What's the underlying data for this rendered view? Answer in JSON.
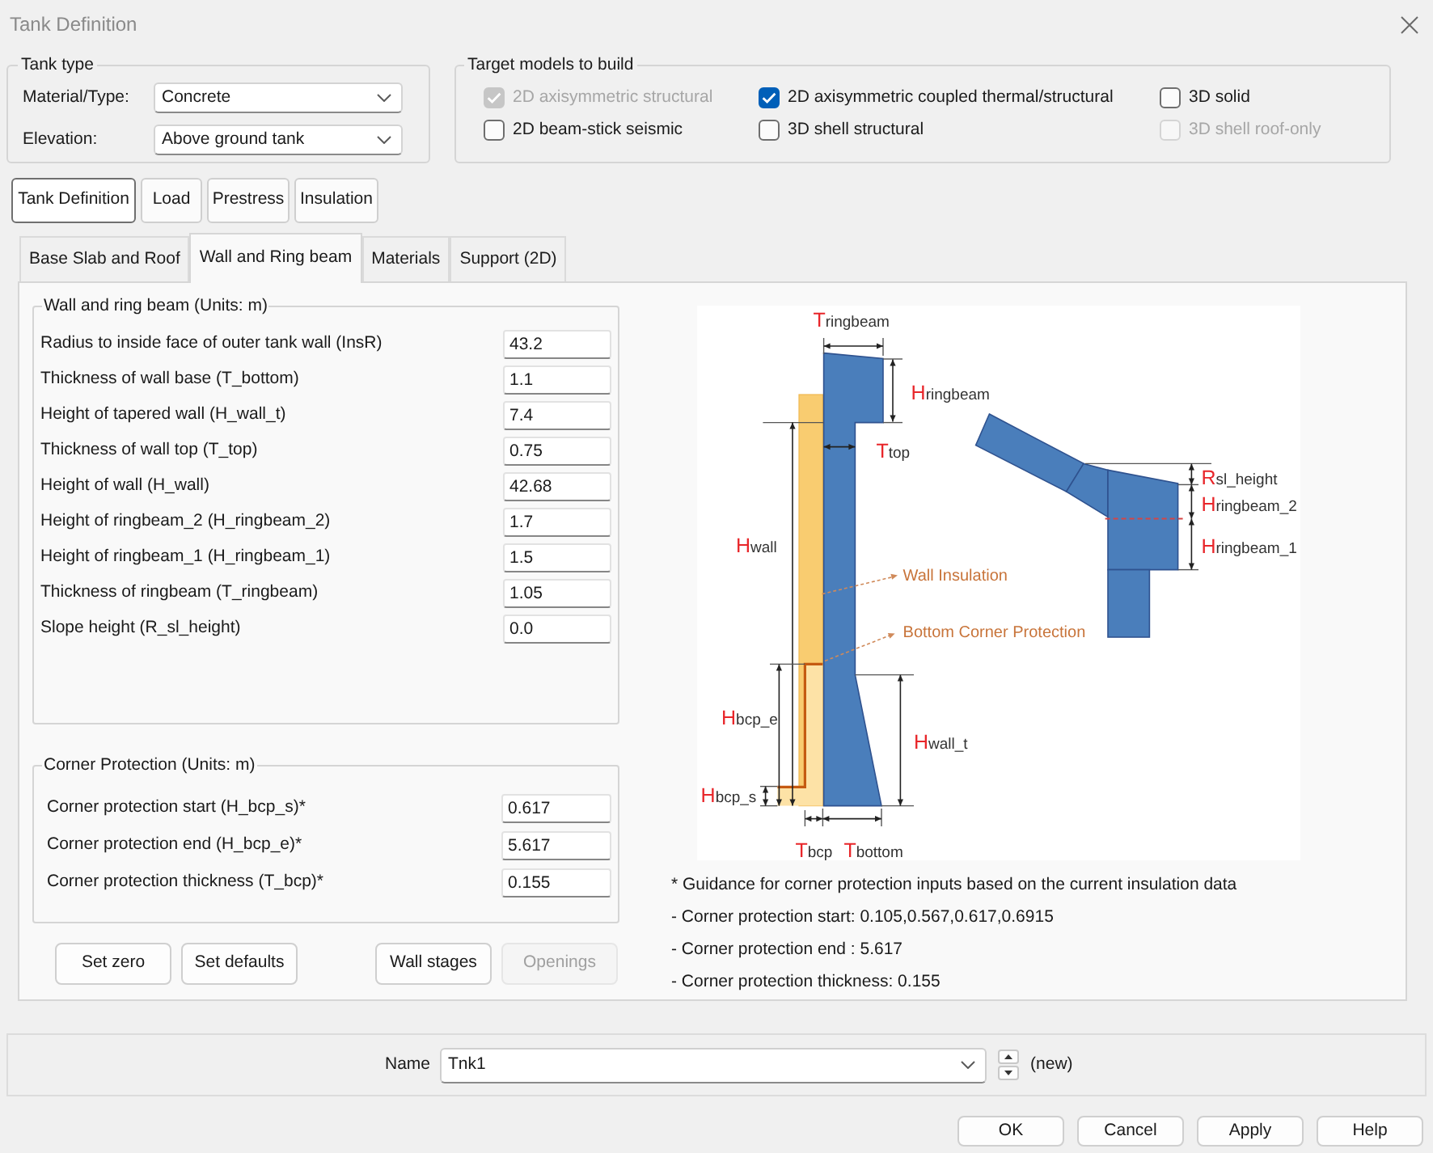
{
  "window": {
    "title": "Tank Definition"
  },
  "tank_type": {
    "title": "Tank type",
    "fields": [
      {
        "label": "Material/Type:",
        "value": "Concrete"
      },
      {
        "label": "Elevation:",
        "value": "Above ground tank"
      }
    ]
  },
  "target_models": {
    "title": "Target models to build",
    "options": [
      {
        "label": "2D axisymmetric structural",
        "checked": true,
        "disabled": true
      },
      {
        "label": "2D axisymmetric coupled thermal/structural",
        "checked": true,
        "disabled": false
      },
      {
        "label": "3D solid",
        "checked": false,
        "disabled": false
      },
      {
        "label": "2D beam-stick seismic",
        "checked": false,
        "disabled": false
      },
      {
        "label": "3D shell structural",
        "checked": false,
        "disabled": false
      },
      {
        "label": "3D shell roof-only",
        "checked": false,
        "disabled": true
      }
    ]
  },
  "main_tabs": [
    {
      "label": "Tank Definition",
      "selected": true
    },
    {
      "label": "Load",
      "selected": false
    },
    {
      "label": "Prestress",
      "selected": false
    },
    {
      "label": "Insulation",
      "selected": false
    }
  ],
  "sub_tabs": [
    {
      "label": "Base Slab and Roof",
      "selected": false
    },
    {
      "label": "Wall and Ring beam",
      "selected": true
    },
    {
      "label": "Materials",
      "selected": false
    },
    {
      "label": "Support (2D)",
      "selected": false
    }
  ],
  "wall_group": {
    "title": "Wall and ring beam (Units: m)",
    "rows": [
      {
        "label": "Radius to inside face of outer tank wall (InsR)",
        "value": "43.2"
      },
      {
        "label": "Thickness of wall base (T_bottom)",
        "value": "1.1"
      },
      {
        "label": "Height of tapered wall (H_wall_t)",
        "value": "7.4"
      },
      {
        "label": "Thickness of wall top (T_top)",
        "value": "0.75"
      },
      {
        "label": "Height of wall (H_wall)",
        "value": "42.68"
      },
      {
        "label": "Height of ringbeam_2 (H_ringbeam_2)",
        "value": "1.7"
      },
      {
        "label": "Height of ringbeam_1 (H_ringbeam_1)",
        "value": "1.5"
      },
      {
        "label": "Thickness of ringbeam (T_ringbeam)",
        "value": "1.05"
      },
      {
        "label": "Slope height (R_sl_height)",
        "value": "0.0"
      }
    ]
  },
  "corner_group": {
    "title": "Corner Protection (Units: m)",
    "rows": [
      {
        "label": "Corner protection start (H_bcp_s)*",
        "value": "0.617"
      },
      {
        "label": "Corner protection end (H_bcp_e)*",
        "value": "5.617"
      },
      {
        "label": "Corner protection thickness (T_bcp)*",
        "value": "0.155"
      }
    ]
  },
  "actions": [
    {
      "label": "Set zero",
      "disabled": false
    },
    {
      "label": "Set defaults",
      "disabled": false
    },
    {
      "label": "Wall stages",
      "disabled": false
    },
    {
      "label": "Openings",
      "disabled": true
    }
  ],
  "diagram": {
    "dimension_labels": [
      {
        "symbol": "T",
        "subscript": "ringbeam"
      },
      {
        "symbol": "H",
        "subscript": "ringbeam"
      },
      {
        "symbol": "T",
        "subscript": "top"
      },
      {
        "symbol": "H",
        "subscript": "wall"
      },
      {
        "symbol": "H",
        "subscript": "bcp_e"
      },
      {
        "symbol": "H",
        "subscript": "wall_t"
      },
      {
        "symbol": "H",
        "subscript": "bcp_s"
      },
      {
        "symbol": "T",
        "subscript": "bcp"
      },
      {
        "symbol": "T",
        "subscript": "bottom"
      },
      {
        "symbol": "R",
        "subscript": "sl_height"
      },
      {
        "symbol": "H",
        "subscript": "ringbeam_2"
      },
      {
        "symbol": "H",
        "subscript": "ringbeam_1"
      }
    ],
    "callouts": [
      "Wall Insulation",
      "Bottom Corner Protection"
    ]
  },
  "guidance": [
    "* Guidance for corner protection inputs based on the current insulation data",
    "- Corner protection start: 0.105,0.567,0.617,0.6915",
    "- Corner protection end : 5.617",
    "- Corner protection thickness: 0.155"
  ],
  "name_bar": {
    "label": "Name",
    "value": "Tnk1",
    "status": "(new)"
  },
  "buttons": [
    "OK",
    "Cancel",
    "Apply",
    "Help"
  ]
}
